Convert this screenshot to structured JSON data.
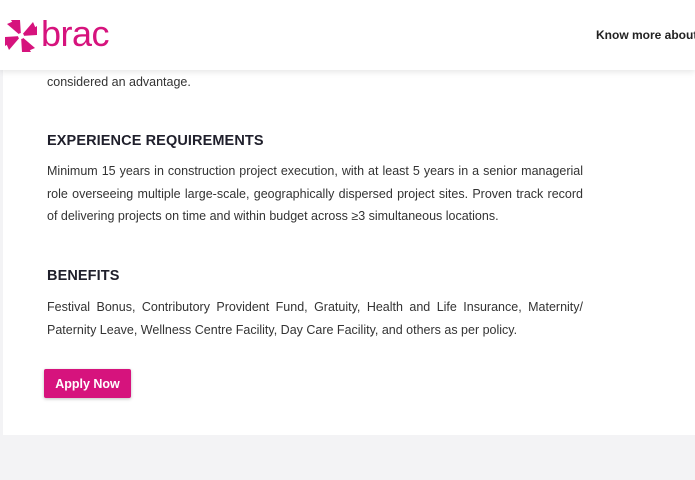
{
  "header": {
    "logo_text": "brac",
    "nav_link": "Know more about B"
  },
  "content": {
    "intro_tail": "considered an advantage.",
    "experience": {
      "title": "EXPERIENCE REQUIREMENTS",
      "text": "Minimum 15 years in construction project execution, with at least 5 years in a senior managerial role overseeing multiple large-scale, geographically dispersed project sites. Proven track record of delivering projects on time and within budget across ≥3 simultaneous locations."
    },
    "benefits": {
      "title": "BENEFITS",
      "text": "Festival Bonus, Contributory Provident Fund, Gratuity, Health and Life Insurance, Maternity/ Paternity Leave, Wellness Centre Facility, Day Care Facility, and others as per policy."
    },
    "apply_label": "Apply Now"
  },
  "colors": {
    "brand": "#d6137d",
    "page_bg": "#f3f3f5"
  },
  "icons": {
    "logo": "brac-pinwheel-logo-icon"
  }
}
